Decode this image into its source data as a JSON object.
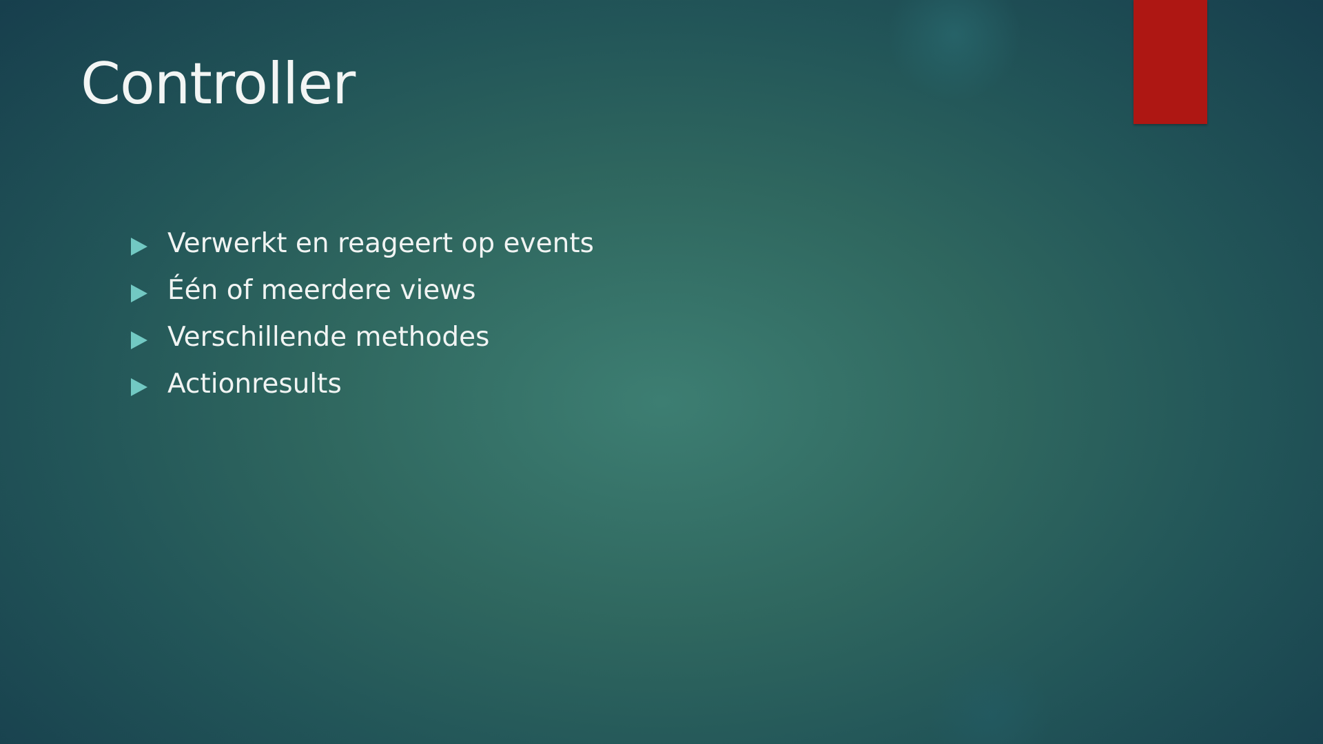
{
  "slide": {
    "title": "Controller",
    "bullets": [
      {
        "text": "Verwerkt en reageert op events",
        "icon": "triangle-right-icon"
      },
      {
        "text": "Één of meerdere views",
        "icon": "triangle-right-icon"
      },
      {
        "text": "Verschillende methodes",
        "icon": "triangle-right-icon"
      },
      {
        "text": "Actionresults",
        "icon": "triangle-right-icon"
      }
    ]
  },
  "colors": {
    "background_center": "#3d7e72",
    "background_edge": "#173f4d",
    "accent_tab": "#ae1713",
    "bullet": "#72c9c3",
    "text": "#f1f4f3"
  }
}
